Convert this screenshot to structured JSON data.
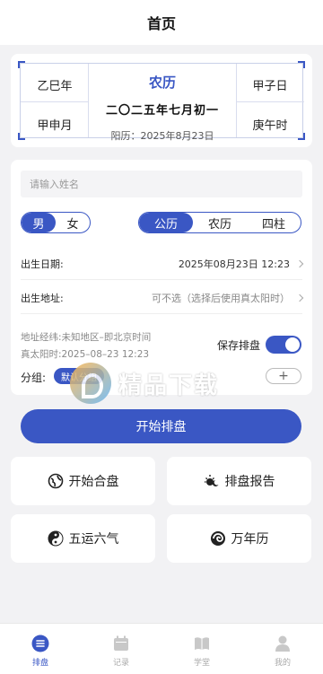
{
  "header": {
    "title": "首页"
  },
  "calendar": {
    "year_gz": "乙巳年",
    "month_gz": "甲申月",
    "day_gz": "甲子日",
    "hour_gz": "庚午时",
    "nongli_label": "农历",
    "nongli_date": "二〇二五年七月初一",
    "solar_date": "阳历：2025年8月23日"
  },
  "form": {
    "name_placeholder": "请输入姓名",
    "gender": {
      "options": [
        "男",
        "女"
      ],
      "selected": "男"
    },
    "calendar_type": {
      "options": [
        "公历",
        "农历",
        "四柱"
      ],
      "selected": "公历"
    },
    "birth_date_label": "出生日期:",
    "birth_date_value": "2025年08月23日 12:23",
    "birth_place_label": "出生地址:",
    "birth_place_value": "可不选（选择后使用真太阳时）",
    "address_info": "地址经纬:未知地区–即北京时间",
    "true_solar_time": "真太阳时:2025–08–23 12:23",
    "save_label": "保存排盘",
    "save_enabled": true,
    "group_label": "分组:",
    "group_tag": "默认分组",
    "add_symbol": "+"
  },
  "start_button": "开始排盘",
  "tiles": [
    {
      "label": "开始合盘",
      "icon": "globe-icon"
    },
    {
      "label": "排盘报告",
      "icon": "sun-moon-icon"
    },
    {
      "label": "五运六气",
      "icon": "yin-yang-icon"
    },
    {
      "label": "万年历",
      "icon": "swirl-icon"
    }
  ],
  "watermark": {
    "text": "精品下载"
  },
  "tabbar": {
    "items": [
      {
        "label": "排盘",
        "icon": "chart-icon",
        "active": true
      },
      {
        "label": "记录",
        "icon": "calendar-icon",
        "active": false
      },
      {
        "label": "学堂",
        "icon": "book-icon",
        "active": false
      },
      {
        "label": "我的",
        "icon": "user-icon",
        "active": false
      }
    ]
  },
  "colors": {
    "accent": "#3a57c4",
    "background": "#f2f2f4"
  }
}
